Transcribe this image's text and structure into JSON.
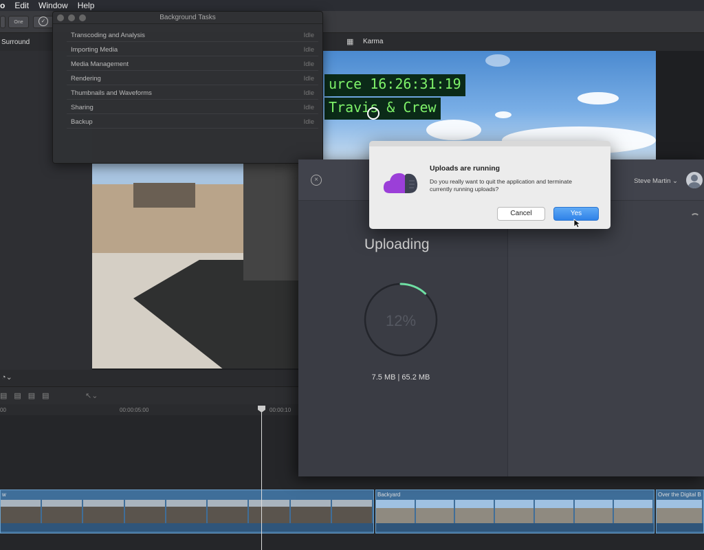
{
  "menubar": {
    "items": [
      "o",
      "Edit",
      "Window",
      "Help"
    ]
  },
  "toolbar": {
    "button_label": "One"
  },
  "viewer": {
    "left_label": "Surround",
    "project_name": "Karma",
    "timecode_line1": "urce 16:26:31:19",
    "timecode_line2": "Travis & Crew"
  },
  "background_tasks": {
    "title": "Background Tasks",
    "tasks": [
      {
        "name": "Transcoding and Analysis",
        "status": "Idle"
      },
      {
        "name": "Importing Media",
        "status": "Idle"
      },
      {
        "name": "Media Management",
        "status": "Idle"
      },
      {
        "name": "Rendering",
        "status": "Idle"
      },
      {
        "name": "Thumbnails and Waveforms",
        "status": "Idle"
      },
      {
        "name": "Sharing",
        "status": "Idle"
      },
      {
        "name": "Backup",
        "status": "Idle"
      }
    ]
  },
  "timeline": {
    "ruler_marks": [
      "00",
      "00:00:05:00",
      "00:00:10"
    ],
    "clips": [
      {
        "label": "w"
      },
      {
        "label": "Backyard"
      },
      {
        "label": "Over the Digital B"
      }
    ]
  },
  "uploader": {
    "user_name": "Steve Martin",
    "title": "Uploading",
    "percent_label": "12%",
    "progress_fraction": 0.12,
    "size_label": "7.5 MB | 65.2 MB",
    "accent_color": "#6fe0a4"
  },
  "alert": {
    "title": "Uploads are running",
    "message": "Do you really want to quit the application and terminate currently running uploads?",
    "cancel_label": "Cancel",
    "confirm_label": "Yes"
  }
}
